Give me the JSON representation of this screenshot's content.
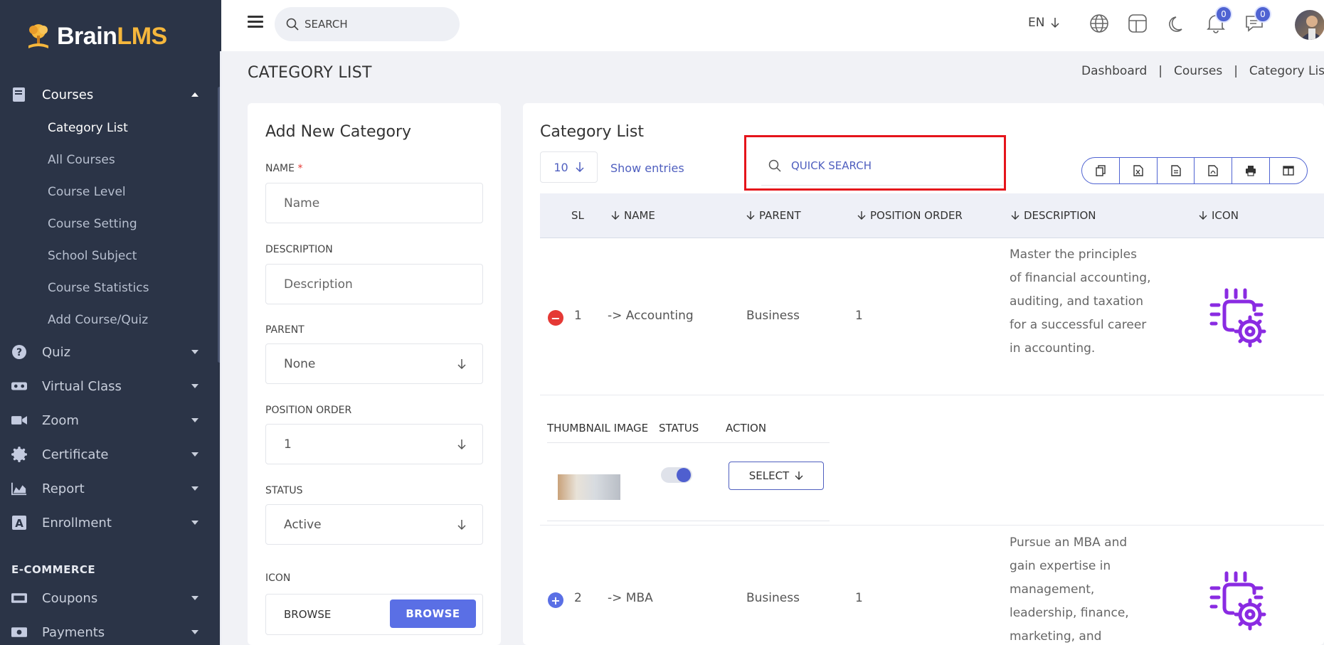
{
  "brand": {
    "part1": "Brain",
    "part2": "LMS"
  },
  "topbar": {
    "search_placeholder": "SEARCH",
    "language": "EN",
    "notifications_count": "0",
    "messages_count": "0"
  },
  "sidebar": {
    "courses": {
      "label": "Courses",
      "items": [
        "Category List",
        "All Courses",
        "Course Level",
        "Course Setting",
        "School Subject",
        "Course Statistics",
        "Add Course/Quiz"
      ]
    },
    "menu": [
      "Quiz",
      "Virtual Class",
      "Zoom",
      "Certificate",
      "Report",
      "Enrollment"
    ],
    "section_ecommerce": "E-COMMERCE",
    "ecommerce": [
      "Coupons",
      "Payments"
    ]
  },
  "page": {
    "title": "CATEGORY LIST",
    "breadcrumb": [
      "Dashboard",
      "Courses",
      "Category List"
    ]
  },
  "add_form": {
    "title": "Add New Category",
    "name_label": "NAME",
    "name_required": "*",
    "name_placeholder": "Name",
    "description_label": "DESCRIPTION",
    "description_placeholder": "Description",
    "parent_label": "PARENT",
    "parent_value": "None",
    "position_label": "POSITION ORDER",
    "position_value": "1",
    "status_label": "STATUS",
    "status_value": "Active",
    "icon_label": "ICON",
    "browse_text": "BROWSE",
    "browse_button": "BROWSE"
  },
  "list": {
    "title": "Category List",
    "entries_value": "10",
    "show_entries": "Show entries",
    "quick_search_placeholder": "QUICK SEARCH",
    "columns": [
      "SL",
      "NAME",
      "PARENT",
      "POSITION ORDER",
      "DESCRIPTION",
      "ICON"
    ],
    "child_columns": [
      "THUMBNAIL IMAGE",
      "STATUS",
      "ACTION"
    ],
    "rows": [
      {
        "sl": "1",
        "name": "-> Accounting",
        "parent": "Business",
        "position": "1",
        "description": "Master the principles of financial accounting, auditing, and taxation for a successful career in accounting.",
        "action": "SELECT",
        "status_on": true
      },
      {
        "sl": "2",
        "name": "-> MBA",
        "parent": "Business",
        "position": "1",
        "description": "Pursue an MBA and gain expertise in management, leadership, finance, marketing, and"
      }
    ]
  },
  "colors": {
    "sidebar_bg": "#2b3447",
    "accent": "#5a6fe5",
    "highlight": "#e5141b",
    "icon_purple": "#8a2be2"
  }
}
